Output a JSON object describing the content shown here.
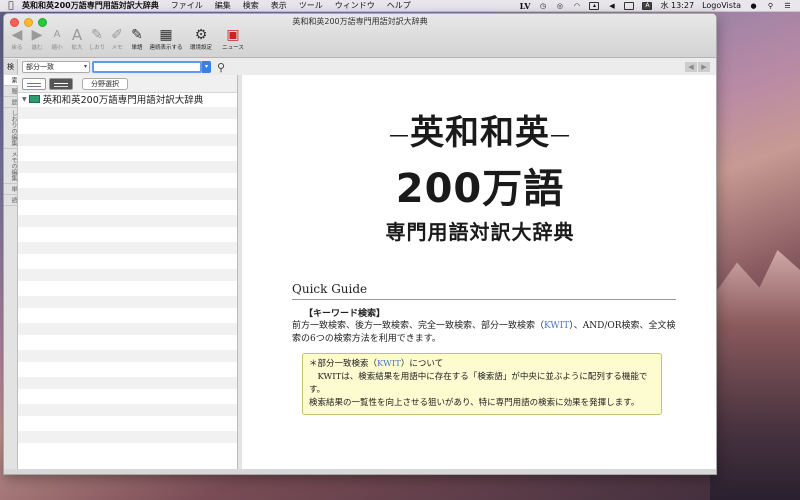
{
  "menubar": {
    "app_name": "英和和英200万語専門用語対訳大辞典",
    "menus": [
      "ファイル",
      "編集",
      "検索",
      "表示",
      "ツール",
      "ウィンドウ",
      "ヘルプ"
    ],
    "status": {
      "lv": "LV",
      "a_label": "A",
      "clock": "水 13:27",
      "input_app": "LogoVista"
    }
  },
  "window": {
    "title": "英和和英200万語専門用語対訳大辞典",
    "toolbar": [
      {
        "label": "戻る",
        "glyph": "◀",
        "active": false
      },
      {
        "label": "進む",
        "glyph": "▶",
        "active": false
      },
      {
        "label": "縮小",
        "glyph": "A",
        "active": false
      },
      {
        "label": "拡大",
        "glyph": "A",
        "active": false
      },
      {
        "label": "しおり",
        "glyph": "✎",
        "active": false
      },
      {
        "label": "メモ",
        "glyph": "✐",
        "active": false
      },
      {
        "label": "単語",
        "glyph": "✎",
        "active": true
      },
      {
        "label": "連続表示する",
        "glyph": "▦",
        "active": true
      },
      {
        "label": "環境設定",
        "glyph": "⚙",
        "active": true
      },
      {
        "label": "ニュース",
        "glyph": "▣",
        "active": true
      }
    ]
  },
  "search": {
    "mode": "部分一致",
    "value": "",
    "field_button": "分野選択"
  },
  "side_tabs": [
    "検",
    "索",
    "履",
    "歴",
    "しおりの編集",
    "メモの編集",
    "単",
    "語"
  ],
  "dictionary_list": [
    "英和和英200万語専門用語対訳大辞典"
  ],
  "content": {
    "logo": {
      "line1": "英和和英",
      "line2": "200万語",
      "line3": "専門用語対訳大辞典"
    },
    "guide_title": "Quick Guide",
    "section1_title": "【キーワード検索】",
    "section1_text_a": "前方一致検索、後方一致検索、完全一致検索、部分一致検索（",
    "kwit": "KWIT",
    "section1_text_b": "）、AND/OR検索、全文検索の6つの検索方法を利用できます。",
    "note_title_a": "＊部分一致検索（",
    "note_title_b": "）について",
    "note_p1": "　KWITは、検索結果を用語中に存在する「検索語」が中央に並ぶように配列する機能です。",
    "note_p2": "検索結果の一覧性を向上させる狙いがあり、特に専門用語の検索に効果を発揮します。"
  }
}
